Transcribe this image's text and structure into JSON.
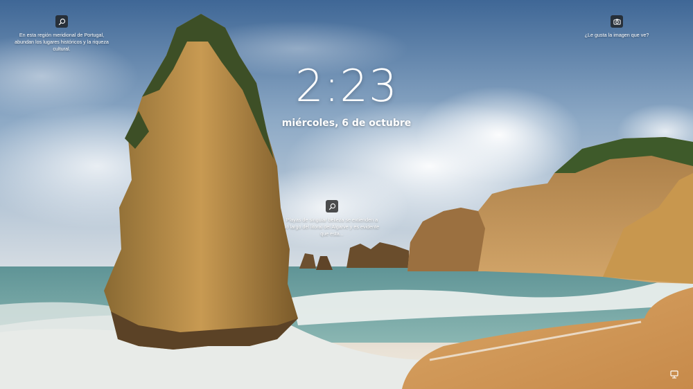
{
  "lockscreen": {
    "time": "2:23",
    "date": "miércoles, 6 de octubre"
  },
  "spotlight": {
    "left": {
      "icon": "search-icon",
      "text": "En esta región meridional de Portugal, abundan los lugares históricos y la riqueza cultural."
    },
    "right": {
      "icon": "camera-icon",
      "text": "¿Le gusta la imagen que ve?"
    },
    "center": {
      "icon": "search-icon",
      "text": "Playas de singular belleza se extienden a lo largo del litoral del Algarve y es evidente que esta..."
    }
  },
  "status": {
    "icon": "network-icon"
  }
}
